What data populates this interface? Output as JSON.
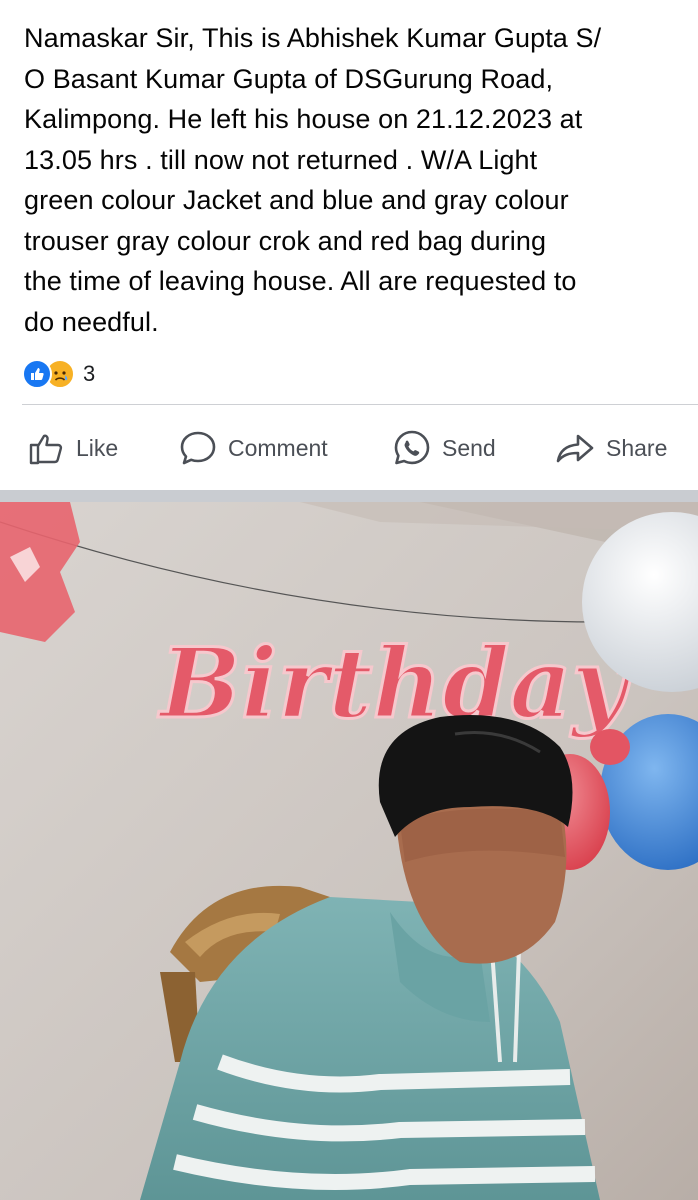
{
  "post": {
    "text": "Namaskar Sir, This is Abhishek Kumar Gupta S/\nO Basant Kumar Gupta of DSGurung Road,\nKalimpong.  He left his house on 21.12.2023 at\n13.05 hrs . till now not returned . W/A Light\ngreen colour Jacket and  blue and gray colour\ntrouser  gray colour crok and    red bag  during\nthe time of leaving house. All are requested to\ndo needful."
  },
  "reactions": {
    "types": [
      "like",
      "sad"
    ],
    "count": "3"
  },
  "actions": {
    "like": "Like",
    "comment": "Comment",
    "send": "Send",
    "share": "Share"
  },
  "photo": {
    "banner_text": "Birthday"
  },
  "colors": {
    "accent": "#1877f2",
    "action_text": "#4b4f56",
    "separator": "#c9ccd1"
  }
}
